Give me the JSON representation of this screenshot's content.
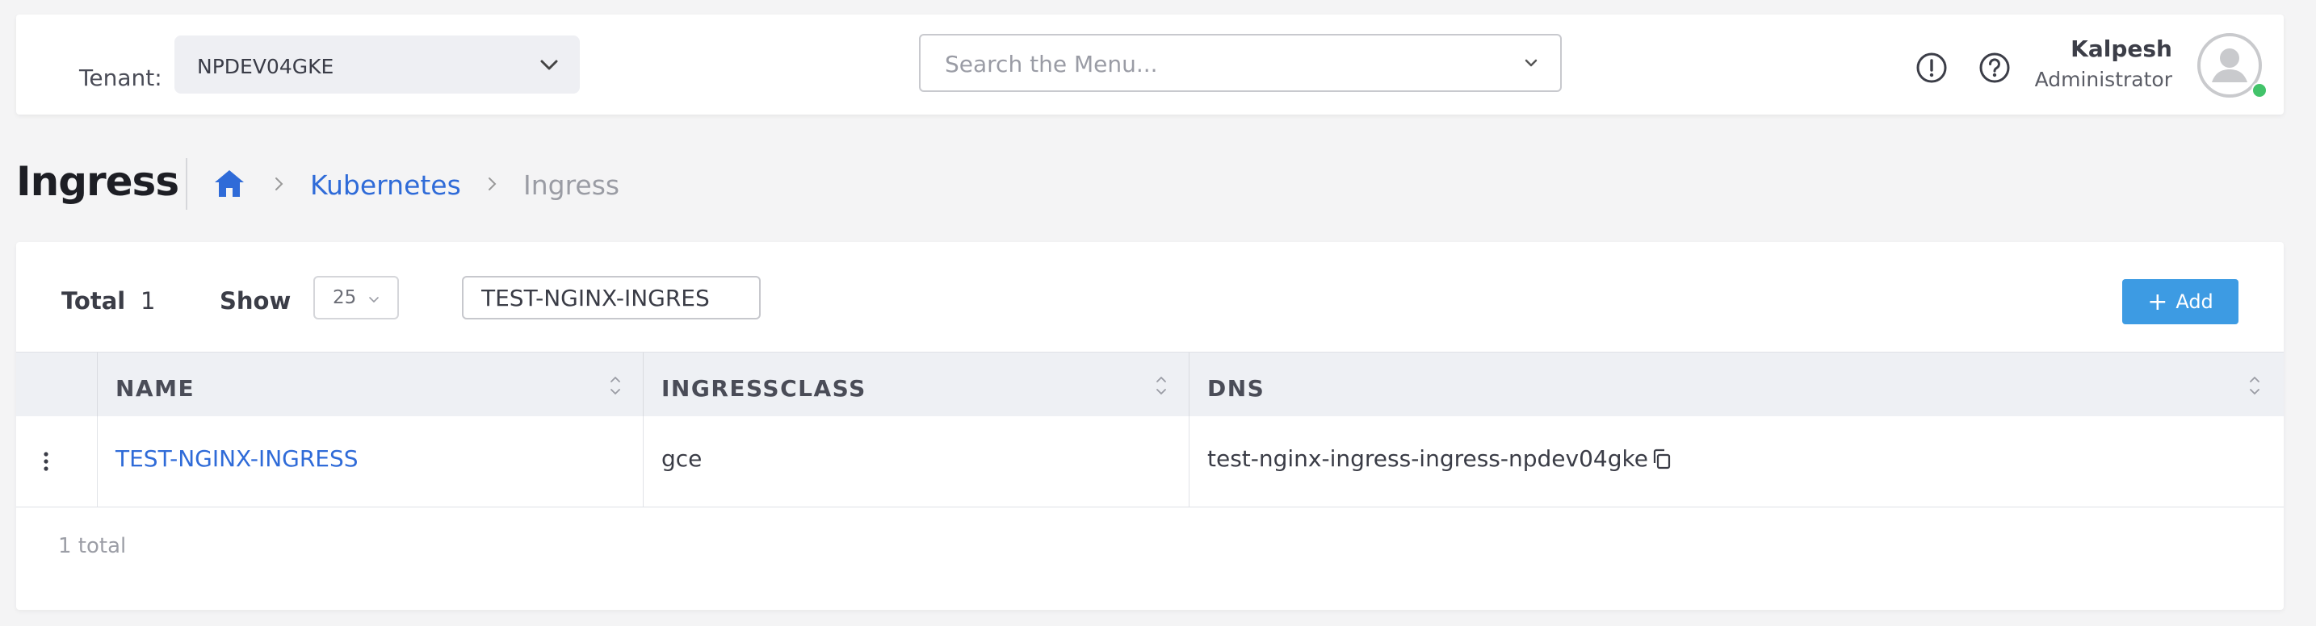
{
  "header": {
    "tenant_label": "Tenant:",
    "tenant_value": "NPDEV04GKE",
    "search_placeholder": "Search the Menu...",
    "user_name": "Kalpesh",
    "user_role": "Administrator",
    "icons": [
      "alert-circle-icon",
      "help-circle-icon",
      "user-avatar-icon"
    ],
    "status_color": "#42c36a"
  },
  "page": {
    "title": "Ingress",
    "breadcrumb": {
      "home_icon": "home-icon",
      "items": [
        "Kubernetes",
        "Ingress"
      ]
    }
  },
  "toolbar": {
    "total_label": "Total",
    "total_value": "1",
    "show_label": "Show",
    "show_value": "25",
    "filter_value": "TEST-NGINX-INGRES",
    "add_label": "Add",
    "add_color": "#3d9be3"
  },
  "table": {
    "columns": [
      "NAME",
      "INGRESSCLASS",
      "DNS"
    ],
    "rows": [
      {
        "name": "TEST-NGINX-INGRESS",
        "ingressclass": "gce",
        "dns": "test-nginx-ingress-ingress-npdev04gke"
      }
    ],
    "footer_total": "1 total"
  },
  "colors": {
    "link": "#2f6bd8",
    "header_bg": "#eef0f4"
  }
}
